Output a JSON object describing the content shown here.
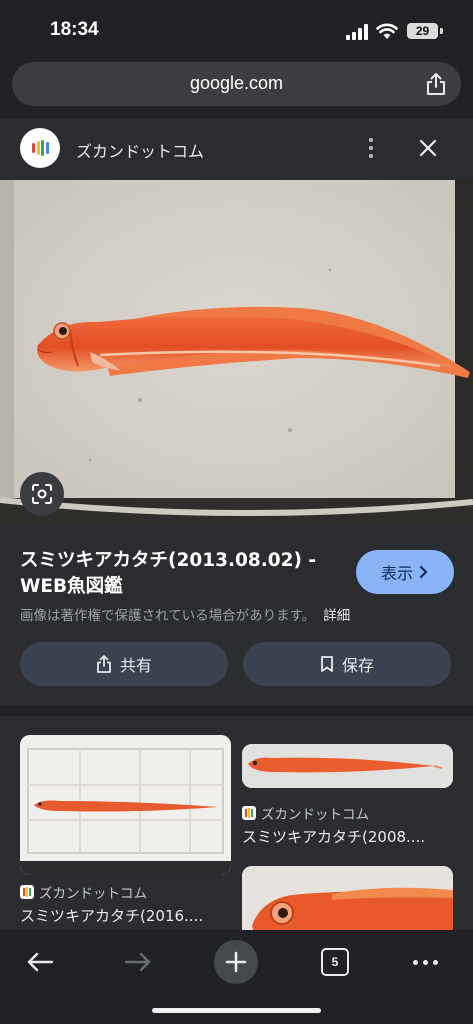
{
  "status": {
    "time": "18:34",
    "battery": "29"
  },
  "browser": {
    "url": "google.com"
  },
  "card": {
    "source_name": "ズカンドットコム",
    "title": "スミツキアカタチ(2013.08.02) - WEB魚図鑑",
    "show_label": "表示",
    "notice": "画像は著作権で保護されている場合があります。",
    "details_label": "詳細",
    "share_label": "共有",
    "save_label": "保存"
  },
  "results": [
    {
      "source": "ズカンドットコム",
      "title": "スミツキアカタチ(2016...."
    },
    {
      "source": "ズカンドットコム",
      "title": "スミツキアカタチ(2008...."
    }
  ],
  "toolbar": {
    "tab_count": "5"
  },
  "colors": {
    "accent": "#8ab4f8",
    "fish": "#e8502a",
    "background": "#1f2124"
  }
}
